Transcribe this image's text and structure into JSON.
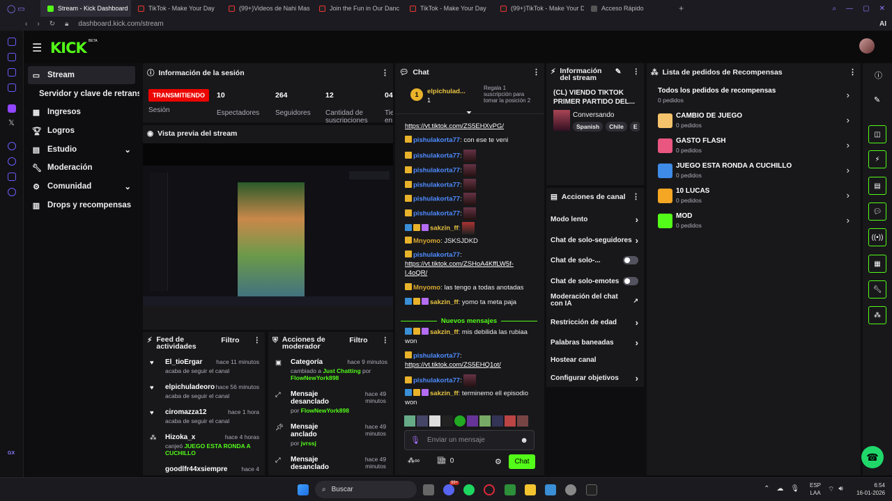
{
  "browser": {
    "tabs": [
      "Stream - Kick Dashboard",
      "TikTok - Make Your Day",
      "(99+)Videos de Nahi Mas",
      "Join the Fun in Our Danc",
      "TikTok - Make Your Day",
      "(99+)TikTok - Make Your D",
      "Acceso Rápido"
    ],
    "url": "dashboard.kick.com/stream",
    "ai_label": "AI"
  },
  "brand": {
    "logo": "KICK",
    "beta": "BETA",
    "accent": "#53fc18"
  },
  "nav": {
    "items": [
      "Stream",
      "Servidor y clave de retransm",
      "Ingresos",
      "Logros",
      "Estudio",
      "Moderación",
      "Comunidad",
      "Drops y recompensas"
    ]
  },
  "session": {
    "title": "Información de la sesión",
    "status": "TRANSMITIENDO",
    "status_label": "Sesión",
    "stats": [
      {
        "value": "10",
        "label": "Espectadores"
      },
      {
        "value": "264",
        "label": "Seguidores"
      },
      {
        "value": "12",
        "label": "Cantidad de suscripciones"
      },
      {
        "value": "04",
        "label": "Tie en"
      }
    ]
  },
  "preview": {
    "title": "Vista previa del stream"
  },
  "feed": {
    "title": "Feed de actividades",
    "filter": "Filtro",
    "rows": [
      {
        "user": "El_tioErgar",
        "time": "hace 11 minutos",
        "sub": "acaba de seguir el canal"
      },
      {
        "user": "elpichuladeoro",
        "time": "hace 56 minutos",
        "sub": "acaba de seguir el canal"
      },
      {
        "user": "ciromazza12",
        "time": "hace 1 hora",
        "sub": "acaba de seguir el canal"
      },
      {
        "user": "Hizoka_x",
        "time": "hace 4 horas",
        "sub1": "canjeó",
        "sub2": "JUEGO ESTA RONDA A CUCHILLO"
      },
      {
        "user": "goodlfr44xsiempre",
        "time": "hace 4"
      }
    ]
  },
  "modactions": {
    "title": "Acciones de moderador",
    "filter": "Filtro",
    "rows": [
      {
        "title": "Categoría",
        "time": "hace 9 minutos",
        "l1": "cambiado a",
        "l1g": "Just Chatting",
        "l1b": "por",
        "l2g": "FlowNewYork898"
      },
      {
        "title": "Mensaje desanclado",
        "time": "hace 49 minutos",
        "l1": "por",
        "l1g": "FlowNewYork898"
      },
      {
        "title": "Mensaje anclado",
        "time": "hace 49 minutos",
        "l1": "por",
        "l1g": "jvrssj"
      },
      {
        "title": "Mensaje desanclado",
        "time": "hace 49 minutos"
      }
    ]
  },
  "chat": {
    "title": "Chat",
    "top_user": "elpichulad...",
    "top_count": "1",
    "gift_text": "Regala 1 suscripción para tomar la posición 2",
    "new_messages": "Nuevos mensajes",
    "input_placeholder": "Enviar un mensaje",
    "send": "Chat",
    "points": "0",
    "messages": [
      {
        "u": "",
        "t": "https://vt.tiktok.com/ZS5EHXvPG/"
      },
      {
        "u": "pishulakorta77",
        "t": ": con ese te veni"
      },
      {
        "u": "pishulakorta77",
        "t": ":"
      },
      {
        "u": "pishulakorta77",
        "t": ":"
      },
      {
        "u": "pishulakorta77",
        "t": ":"
      },
      {
        "u": "pishulakorta77",
        "t": ":"
      },
      {
        "u": "pishulakorta77",
        "t": ":"
      },
      {
        "u": "sakzin_ff",
        "t": ":"
      },
      {
        "u": "Mnyomo",
        "t": ": JSKSJDKD"
      },
      {
        "u": "pishulakorta77",
        "t": ":"
      },
      {
        "u": "",
        "t": "https://vt.tiktok.com/ZSHoA4KffLW5f-l.4oQR/"
      },
      {
        "u": "Mnyomo",
        "t": ": las tengo a todas anotadas"
      },
      {
        "u": "sakzin_ff",
        "t": ": yomo ta meta paja"
      },
      {
        "u": "sakzin_ff",
        "t": ": mis debilida las rubiaa won"
      },
      {
        "u": "pishulakorta77",
        "t": ":"
      },
      {
        "u": "",
        "t": "https://vt.tiktok.com/ZS5EHQ1ot/"
      },
      {
        "u": "pishulakorta77",
        "t": ":"
      },
      {
        "u": "sakzin_ff",
        "t": ": terminemo ell episodio won"
      }
    ]
  },
  "streaminfo": {
    "title": "Información del stream",
    "stream_title": "(CL) VIENDO TIKTOK PRIMER PARTIDO DEL...",
    "category": "Conversando",
    "tags": [
      "Spanish",
      "Chile",
      "E"
    ]
  },
  "channel": {
    "title": "Acciones de canal",
    "items": [
      {
        "label": "Modo lento",
        "kind": "arrow"
      },
      {
        "label": "Chat de solo-seguidores",
        "kind": "arrow"
      },
      {
        "label": "Chat de solo-...",
        "kind": "toggle"
      },
      {
        "label": "Chat de solo-emotes",
        "kind": "toggle"
      },
      {
        "label": "Moderación del chat con IA",
        "kind": "ext"
      },
      {
        "label": "Restricción de edad",
        "kind": "arrow"
      },
      {
        "label": "Palabras baneadas",
        "kind": "arrow"
      },
      {
        "label": "Hostear canal",
        "kind": "none"
      },
      {
        "label": "Configurar objetivos",
        "kind": "arrow"
      }
    ]
  },
  "rewards": {
    "title": "Lista de pedidos de Recompensas",
    "all": "Todos los pedidos de recompensas",
    "all_count": "0 pedidos",
    "items": [
      {
        "name": "CAMBIO DE JUEGO",
        "count": "0 pedidos",
        "color": "#f5c36b"
      },
      {
        "name": "GASTO FLASH",
        "count": "0 pedidos",
        "color": "#e9567f"
      },
      {
        "name": "JUEGO ESTA RONDA A CUCHILLO",
        "count": "0 pedidos",
        "color": "#3f8be8"
      },
      {
        "name": "10 LUCAS",
        "count": "0 pedidos",
        "color": "#f5a623"
      },
      {
        "name": "MOD",
        "count": "0 pedidos",
        "color": "#53fc18"
      }
    ]
  },
  "taskbar": {
    "search": "Buscar",
    "lang1": "ESP",
    "lang2": "LAA",
    "time": "6:54",
    "date": "16-01-2026",
    "badge": "99+"
  }
}
